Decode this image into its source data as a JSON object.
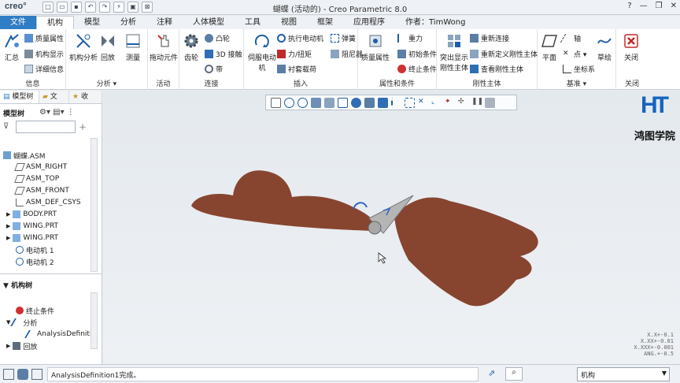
{
  "app": {
    "logo": "creo°",
    "title": "蝴蝶 (活动的) - Creo Parametric 8.0",
    "controls": [
      "?",
      "—",
      "❐",
      "✕"
    ]
  },
  "tabs": [
    "文件",
    "机构",
    "模型",
    "分析",
    "注释",
    "人体模型",
    "工具",
    "视图",
    "框架",
    "应用程序",
    "作者：TimWong"
  ],
  "ribbon": {
    "info": {
      "label": "信息",
      "summary": "汇总",
      "mass_props": "质量属性",
      "mech_display": "机构显示",
      "details": "详细信息"
    },
    "analysis": {
      "label": "分析 ▾",
      "mech_analysis": "机构分析",
      "playback": "回放",
      "measure": "测量"
    },
    "motion": {
      "label": "活动",
      "drag": "拖动元件"
    },
    "connect": {
      "label": "连接",
      "gear": "齿轮",
      "cam": "凸轮",
      "3d_contact": "3D 接触",
      "belt": "带"
    },
    "insert": {
      "label": "插入",
      "servo_motor": "伺服电动机",
      "exec_motor": "执行电动机",
      "force_torque": "力/扭矩",
      "bushing_load": "衬套载荷",
      "spring": "弹簧",
      "damper": "阻尼器"
    },
    "properties": {
      "label": "属性和条件",
      "mass_props": "质量属性",
      "gravity": "重力",
      "initial_cond": "初始条件",
      "termination": "终止条件"
    },
    "rigid_body": {
      "label": "刚性主体",
      "highlight": "突出显示刚性主体",
      "redefine_connection": "重新连接",
      "redefine_rigid": "重新定义刚性主体",
      "view_rigid": "查看刚性主体"
    },
    "datum": {
      "label": "基准 ▾",
      "plane": "平面",
      "axis": "轴",
      "point": "点 ▾",
      "csys": "坐标系",
      "sketch": "草绘"
    },
    "close": {
      "label": "关闭",
      "close": "关闭"
    }
  },
  "left_panel": {
    "tabs": [
      "模型树",
      "文",
      "收"
    ],
    "model_tree_label": "模型树",
    "search_placeholder": "",
    "model_tree": [
      "蝴蝶.ASM",
      "ASM_RIGHT",
      "ASM_TOP",
      "ASM_FRONT",
      "ASM_DEF_CSYS",
      "BODY.PRT",
      "WING.PRT",
      "WING.PRT",
      "电动机 1",
      "电动机 2"
    ],
    "mech_tree_label": "机构树",
    "mech_tree": [
      "终止条件",
      "分析",
      "AnalysisDefiniti",
      "回放"
    ]
  },
  "canvas": {
    "watermark": "鸿图学院",
    "watermark_logo": "HT",
    "scale_readout": [
      "X.X+-0.1",
      "X.XX+-0.01",
      "X.XXX+-0.001",
      "ANG.+-0.5"
    ],
    "wing_color": "#874530"
  },
  "status": {
    "message": "AnalysisDefinition1完成。",
    "filter_value": "机构"
  }
}
